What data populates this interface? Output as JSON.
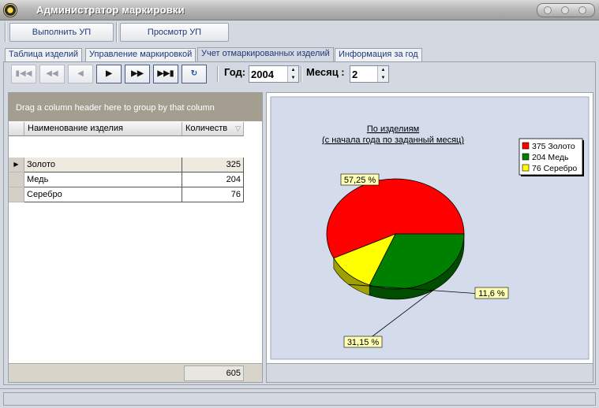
{
  "window": {
    "title": "Администратор маркировки"
  },
  "toolbar": {
    "run_label": "Выполнить УП",
    "view_label": "Просмотр УП"
  },
  "tabs": [
    {
      "label": "Таблица изделий",
      "active": false
    },
    {
      "label": "Управление маркировкой",
      "active": false
    },
    {
      "label": "Учет отмаркированных изделий",
      "active": true
    },
    {
      "label": "Информация за год",
      "active": false
    }
  ],
  "navigator": {
    "icons": [
      "first-icon",
      "prior-page-icon",
      "prior-icon",
      "next-icon",
      "next-page-icon",
      "last-icon",
      "refresh-icon"
    ]
  },
  "filters": {
    "year_label": "Год:",
    "year_value": "2004",
    "month_label": "Месяц :",
    "month_value": "2"
  },
  "grid": {
    "group_hint": "Drag a column header here to group by that column",
    "columns": [
      "Наименование изделия",
      "Количеств"
    ],
    "rows": [
      {
        "name": "Золото",
        "qty": "325"
      },
      {
        "name": "Медь",
        "qty": "204"
      },
      {
        "name": "Серебро",
        "qty": "76"
      }
    ],
    "total": "605"
  },
  "chart_data": {
    "type": "pie",
    "title": "По изделиям",
    "subtitle": "(с начала года по заданный месяц)",
    "categories": [
      "Золото",
      "Медь",
      "Серебро"
    ],
    "values": [
      375,
      204,
      76
    ],
    "percent_labels": [
      "57,25 %",
      "31,15 %",
      "11,6 %"
    ],
    "legend": [
      "375 Золото",
      "204 Медь",
      "76 Серебро"
    ],
    "colors": [
      "#ff0000",
      "#008000",
      "#ffff00"
    ],
    "legend_position": "top-right"
  }
}
